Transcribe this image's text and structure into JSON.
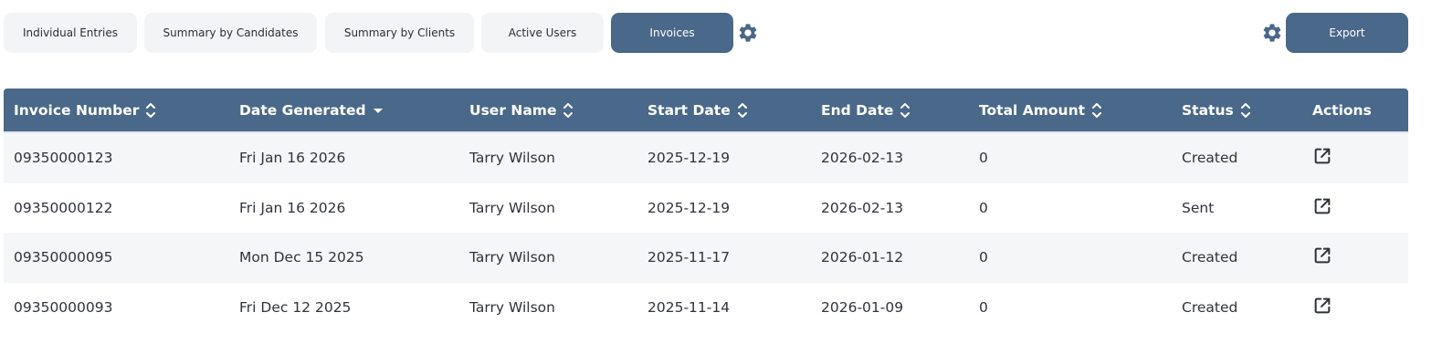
{
  "toolbar": {
    "tabs": [
      {
        "label": "Individual Entries",
        "active": false
      },
      {
        "label": "Summary by Candidates",
        "active": false
      },
      {
        "label": "Summary by Clients",
        "active": false
      },
      {
        "label": "Active Users",
        "active": false
      },
      {
        "label": "Invoices",
        "active": true
      }
    ],
    "export_label": "Export",
    "settings_icon": "gear-icon"
  },
  "colors": {
    "accent": "#4a6889",
    "tab_background": "#f3f4f6",
    "row_alt": "#f5f6f8"
  },
  "table": {
    "columns": [
      {
        "label": "Invoice Number",
        "sort": "both"
      },
      {
        "label": "Date Generated",
        "sort": "desc"
      },
      {
        "label": "User Name",
        "sort": "both"
      },
      {
        "label": "Start Date",
        "sort": "both"
      },
      {
        "label": "End Date",
        "sort": "both"
      },
      {
        "label": "Total Amount",
        "sort": "both"
      },
      {
        "label": "Status",
        "sort": "both"
      },
      {
        "label": "Actions",
        "sort": "none"
      }
    ],
    "rows": [
      {
        "invoice_number": "09350000123",
        "date_generated": "Fri Jan 16 2026",
        "user_name": "Tarry Wilson",
        "start_date": "2025-12-19",
        "end_date": "2026-02-13",
        "total_amount": "0",
        "status": "Created",
        "action_icon": "open-external-icon"
      },
      {
        "invoice_number": "09350000122",
        "date_generated": "Fri Jan 16 2026",
        "user_name": "Tarry Wilson",
        "start_date": "2025-12-19",
        "end_date": "2026-02-13",
        "total_amount": "0",
        "status": "Sent",
        "action_icon": "open-external-icon"
      },
      {
        "invoice_number": "09350000095",
        "date_generated": "Mon Dec 15 2025",
        "user_name": "Tarry Wilson",
        "start_date": "2025-11-17",
        "end_date": "2026-01-12",
        "total_amount": "0",
        "status": "Created",
        "action_icon": "open-external-icon"
      },
      {
        "invoice_number": "09350000093",
        "date_generated": "Fri Dec 12 2025",
        "user_name": "Tarry Wilson",
        "start_date": "2025-11-14",
        "end_date": "2026-01-09",
        "total_amount": "0",
        "status": "Created",
        "action_icon": "open-external-icon"
      }
    ]
  }
}
